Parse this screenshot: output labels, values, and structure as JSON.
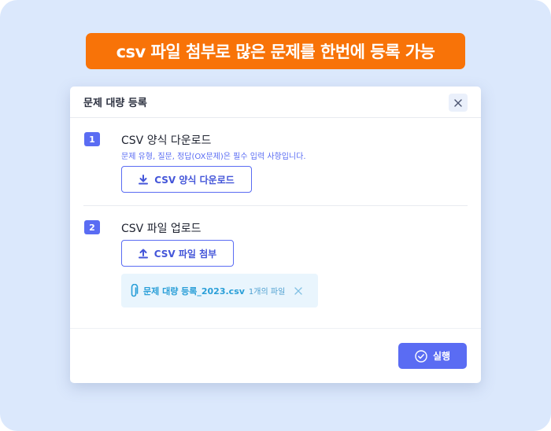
{
  "banner": {
    "text": "csv 파일 첨부로 많은 문제를 한번에 등록 가능"
  },
  "modal": {
    "title": "문제 대량 등록",
    "close_icon": "close-icon"
  },
  "steps": [
    {
      "number": "1",
      "title": "CSV 양식 다운로드",
      "description": "문제 유형, 질문, 정답(OX문제)은 필수 입력 사항입니다.",
      "button_label": "CSV 양식 다운로드",
      "button_icon": "download-icon"
    },
    {
      "number": "2",
      "title": "CSV 파일 업로드",
      "button_label": "CSV 파일 첨부",
      "button_icon": "upload-icon",
      "file": {
        "name": "문제 대량 등록_2023.csv",
        "count": "1개의 파일",
        "icon": "paperclip-icon"
      }
    }
  ],
  "footer": {
    "run_label": "실행",
    "run_icon": "check-circle-icon"
  },
  "colors": {
    "accent": "#5a6cf3",
    "banner": "#f87308",
    "background": "#dbe8fc",
    "file_text": "#2a9fd8"
  }
}
